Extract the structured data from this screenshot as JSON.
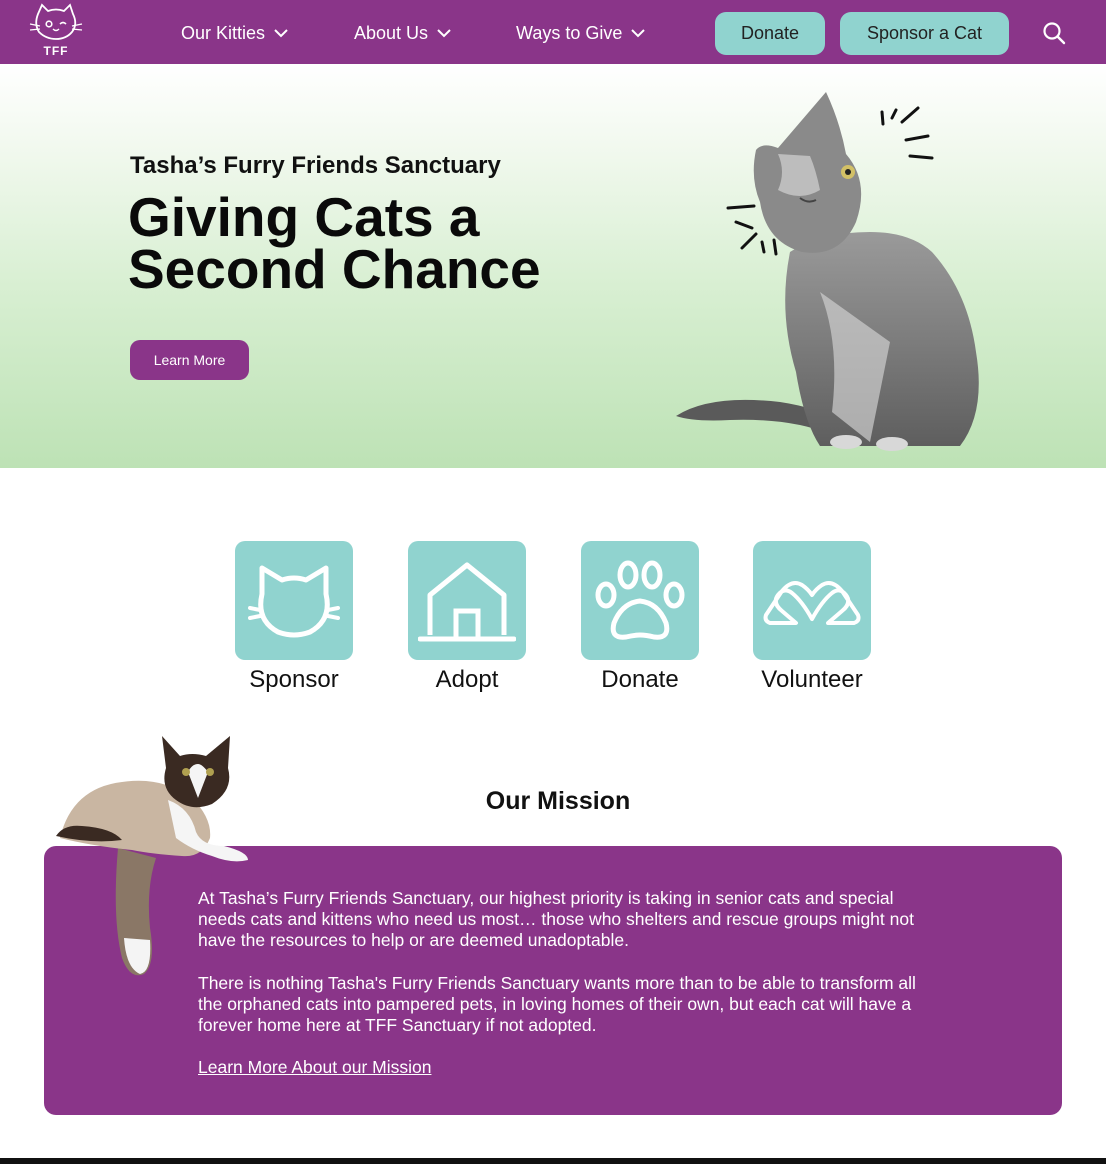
{
  "colors": {
    "brand_purple": "#8a3589",
    "teal": "#90d3cf",
    "hero_green": "#bde2b5"
  },
  "header": {
    "logo_text": "TFF",
    "logo_icon": "cat-face-icon",
    "nav": [
      {
        "label": "Our Kitties",
        "icon": "chevron-down-icon"
      },
      {
        "label": "About Us",
        "icon": "chevron-down-icon"
      },
      {
        "label": "Ways to Give",
        "icon": "chevron-down-icon"
      }
    ],
    "donate_label": "Donate",
    "sponsor_label": "Sponsor a Cat",
    "search_icon": "search-icon"
  },
  "hero": {
    "subtitle": "Tasha’s Furry Friends Sanctuary",
    "title": "Giving Cats a Second Chance",
    "button_label": "Learn More"
  },
  "actions": [
    {
      "label": "Sponsor",
      "icon": "cat-head-icon"
    },
    {
      "label": "Adopt",
      "icon": "house-icon"
    },
    {
      "label": "Donate",
      "icon": "paw-icon"
    },
    {
      "label": "Volunteer",
      "icon": "heart-hands-icon"
    }
  ],
  "mission": {
    "title": "Our Mission",
    "paragraph1": "At Tasha’s Furry Friends Sanctuary, our highest priority is taking in senior cats and special needs cats and kittens who need us most… those who shelters and rescue groups might not have the resources to help or are deemed unadoptable.",
    "paragraph2": "There is nothing Tasha's Furry Friends Sanctuary wants more than to be able to transform all the orphaned cats into pampered pets, in loving homes of their own, but each cat will have a forever home here at TFF Sanctuary if not adopted.",
    "link_label": "Learn More About our Mission"
  }
}
